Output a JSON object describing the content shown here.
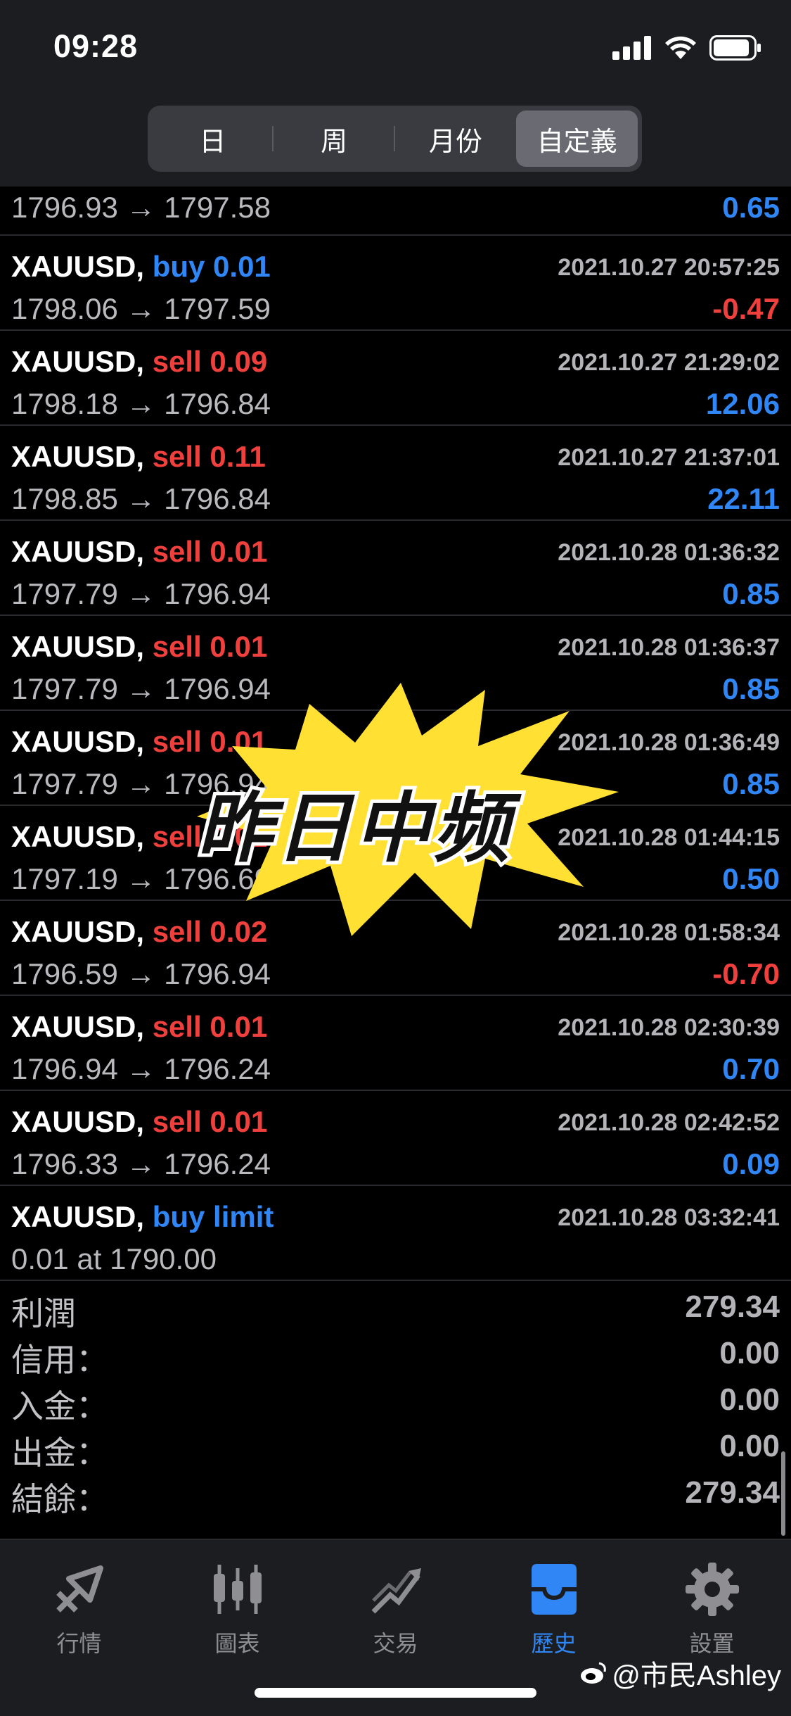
{
  "status": {
    "time": "09:28"
  },
  "period_tabs": [
    {
      "label": "日",
      "active": false
    },
    {
      "label": "周",
      "active": false
    },
    {
      "label": "月份",
      "active": false
    },
    {
      "label": "自定義",
      "active": true
    }
  ],
  "first_row": {
    "prices": "1796.93 → 1797.58",
    "profit": "0.65"
  },
  "trades": [
    {
      "symbol": "XAUUSD,",
      "side": "buy 0.01",
      "side_type": "buy",
      "date": "2021.10.27 20:57:25",
      "prices": "1798.06 → 1797.59",
      "profit": "-0.47",
      "profit_sign": "neg"
    },
    {
      "symbol": "XAUUSD,",
      "side": "sell 0.09",
      "side_type": "sell",
      "date": "2021.10.27 21:29:02",
      "prices": "1798.18 → 1796.84",
      "profit": "12.06",
      "profit_sign": "pos"
    },
    {
      "symbol": "XAUUSD,",
      "side": "sell 0.11",
      "side_type": "sell",
      "date": "2021.10.27 21:37:01",
      "prices": "1798.85 → 1796.84",
      "profit": "22.11",
      "profit_sign": "pos"
    },
    {
      "symbol": "XAUUSD,",
      "side": "sell 0.01",
      "side_type": "sell",
      "date": "2021.10.28 01:36:32",
      "prices": "1797.79 → 1796.94",
      "profit": "0.85",
      "profit_sign": "pos"
    },
    {
      "symbol": "XAUUSD,",
      "side": "sell 0.01",
      "side_type": "sell",
      "date": "2021.10.28 01:36:37",
      "prices": "1797.79 → 1796.94",
      "profit": "0.85",
      "profit_sign": "pos"
    },
    {
      "symbol": "XAUUSD,",
      "side": "sell 0.01",
      "side_type": "sell",
      "date": "2021.10.28 01:36:49",
      "prices": "1797.79 → 1796.94",
      "profit": "0.85",
      "profit_sign": "pos"
    },
    {
      "symbol": "XAUUSD,",
      "side": "sell 0.01",
      "side_type": "sell",
      "date": "2021.10.28 01:44:15",
      "prices": "1797.19 → 1796.69",
      "profit": "0.50",
      "profit_sign": "pos"
    },
    {
      "symbol": "XAUUSD,",
      "side": "sell 0.02",
      "side_type": "sell",
      "date": "2021.10.28 01:58:34",
      "prices": "1796.59 → 1796.94",
      "profit": "-0.70",
      "profit_sign": "neg"
    },
    {
      "symbol": "XAUUSD,",
      "side": "sell 0.01",
      "side_type": "sell",
      "date": "2021.10.28 02:30:39",
      "prices": "1796.94 → 1796.24",
      "profit": "0.70",
      "profit_sign": "pos"
    },
    {
      "symbol": "XAUUSD,",
      "side": "sell 0.01",
      "side_type": "sell",
      "date": "2021.10.28 02:42:52",
      "prices": "1796.33 → 1796.24",
      "profit": "0.09",
      "profit_sign": "pos"
    },
    {
      "symbol": "XAUUSD,",
      "side": "buy limit",
      "side_type": "buy",
      "date": "2021.10.28 03:32:41",
      "prices": "0.01 at 1790.00",
      "profit": "",
      "profit_sign": "pos"
    }
  ],
  "summary": [
    {
      "label": "利潤",
      "value": "279.34"
    },
    {
      "label": "信用：",
      "value": "0.00"
    },
    {
      "label": "入金：",
      "value": "0.00"
    },
    {
      "label": "出金：",
      "value": "0.00"
    },
    {
      "label": "結餘：",
      "value": "279.34"
    }
  ],
  "tabbar": [
    {
      "label": "行情",
      "icon": "quotes-icon",
      "active": false
    },
    {
      "label": "圖表",
      "icon": "chart-candles-icon",
      "active": false
    },
    {
      "label": "交易",
      "icon": "trade-icon",
      "active": false
    },
    {
      "label": "歷史",
      "icon": "history-inbox-icon",
      "active": true
    },
    {
      "label": "設置",
      "icon": "gear-icon",
      "active": false
    }
  ],
  "sticker": {
    "text": "昨日中频"
  },
  "watermark": {
    "text": "@市民Ashley"
  },
  "colors": {
    "buy": "#2f86f4",
    "sell": "#f0403d",
    "sticker": "#ffe033",
    "background": "#000000",
    "header": "#1c1d21"
  }
}
